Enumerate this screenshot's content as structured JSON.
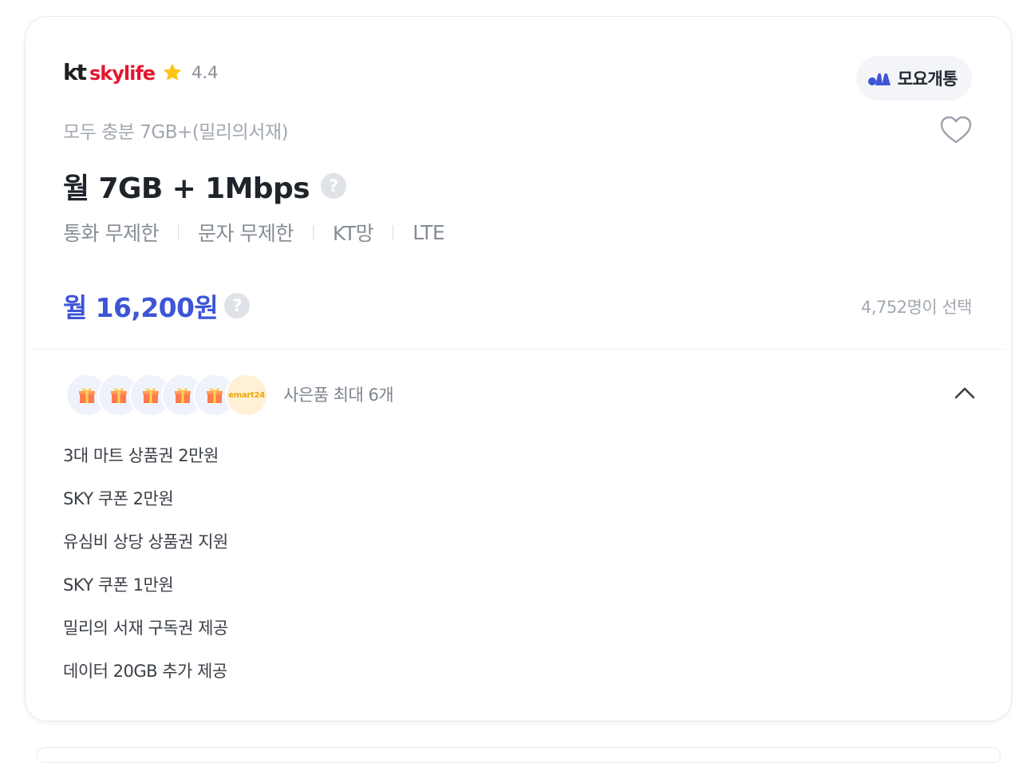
{
  "card": {
    "brand": {
      "logo_kt": "kt",
      "logo_skylife": "skylife",
      "rating": "4.4"
    },
    "badge_label": "모요개통",
    "plan_name": "모두 충분 7GB+(밀리의서재)",
    "data_title": "월 7GB + 1Mbps",
    "help_icon_text": "?",
    "specs": [
      "통화 무제한",
      "문자 무제한",
      "KT망",
      "LTE"
    ],
    "price": "월 16,200원",
    "selected_count": "4,752명이 선택",
    "gifts": {
      "summary": "사은품 최대 6개",
      "emart_label": "emart24",
      "items": [
        "3대 마트 상품권 2만원",
        "SKY 쿠폰 2만원",
        "유심비 상당 상품권 지원",
        "SKY 쿠폰 1만원",
        "밀리의 서재 구독권 제공",
        "데이터 20GB 추가 제공"
      ]
    }
  },
  "colors": {
    "price_blue": "#3d55d6",
    "skylife_red": "#e8152f",
    "star_yellow": "#ffc21a",
    "muted_gray": "#a2a8b0"
  },
  "icons": [
    "star-icon",
    "moyo-logo-icon",
    "heart-icon",
    "help-icon",
    "gift-icon",
    "chevron-up-icon"
  ]
}
